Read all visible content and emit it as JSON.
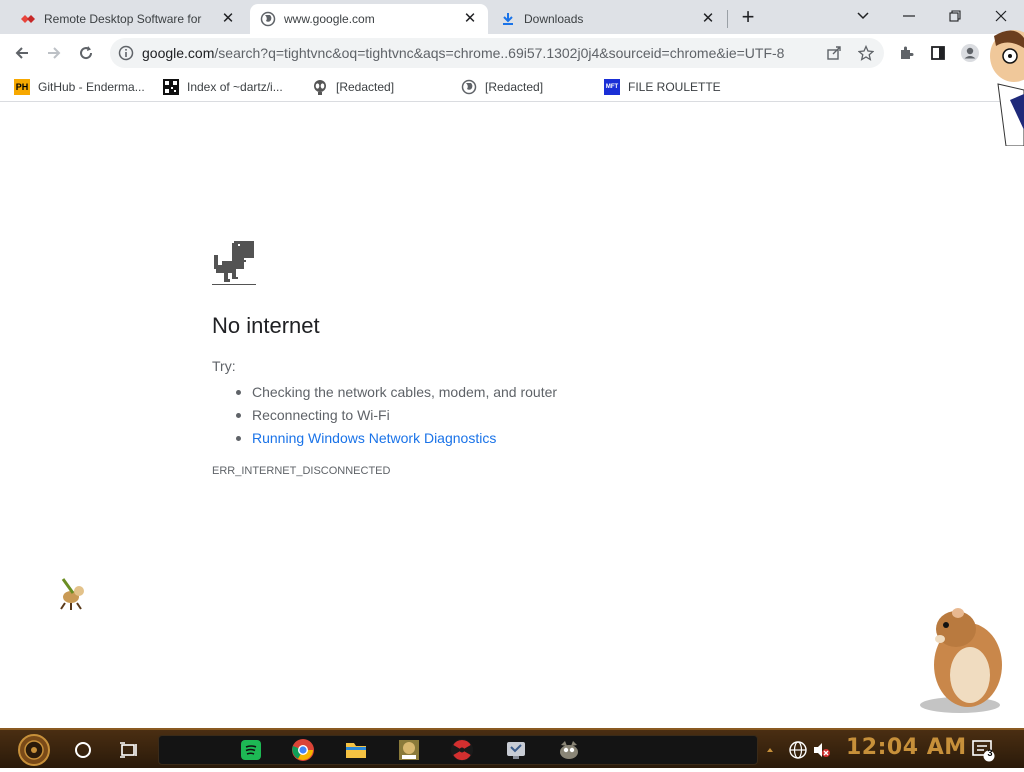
{
  "tabs": [
    {
      "title": "Remote Desktop Software for",
      "icon": "remote-desktop-icon",
      "active": false
    },
    {
      "title": "www.google.com",
      "icon": "globe-icon",
      "active": true
    },
    {
      "title": "Downloads",
      "icon": "download-icon",
      "active": false
    }
  ],
  "toolbar": {
    "url_host": "google.com",
    "url_path": "/search?q=tightvnc&oq=tightvnc&aqs=chrome..69i57.1302j0j4&sourceid=chrome&ie=UTF-8"
  },
  "bookmarks": [
    {
      "label": "GitHub - Enderma...",
      "icon": "ph-icon"
    },
    {
      "label": "Index of ~dartz/i...",
      "icon": "qr-icon"
    },
    {
      "label": "[Redacted]",
      "icon": "alien-icon"
    },
    {
      "label": "[Redacted]",
      "icon": "globe-icon"
    },
    {
      "label": "FILE ROULETTE",
      "icon": "mft-icon"
    }
  ],
  "error_page": {
    "heading": "No internet",
    "try_label": "Try:",
    "suggestions": [
      "Checking the network cables, modem, and router",
      "Reconnecting to Wi-Fi",
      "Running Windows Network Diagnostics"
    ],
    "error_code": "ERR_INTERNET_DISCONNECTED"
  },
  "taskbar": {
    "clock": "12:04 AM",
    "notification_count": "3"
  },
  "colors": {
    "link": "#1a73e8",
    "text": "#202124",
    "muted": "#5f6368",
    "taskbar": "#2a1a0a",
    "clock": "#c7903a"
  }
}
